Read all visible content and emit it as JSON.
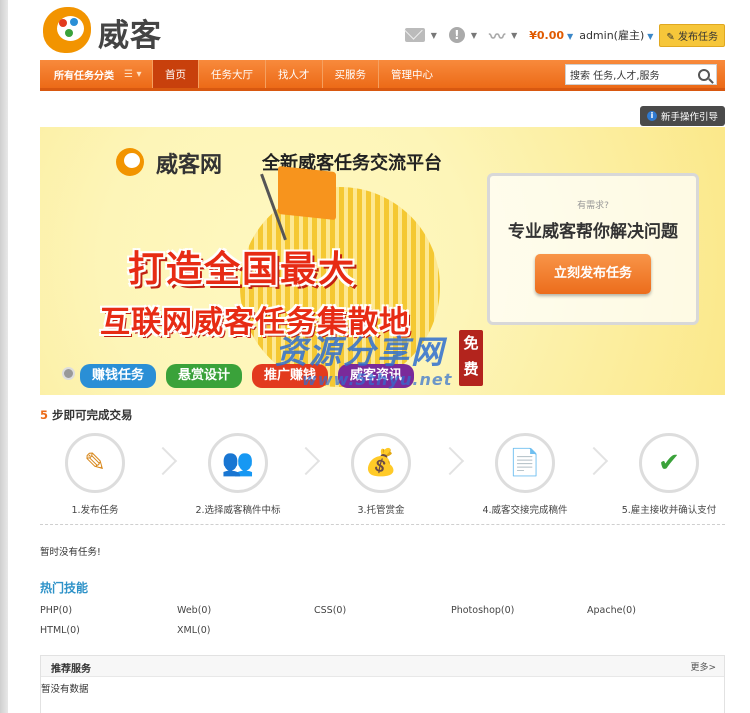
{
  "header": {
    "logo_text": "威客",
    "balance": "¥0.00",
    "user": "admin(雇主)",
    "post_task": "发布任务",
    "icons": [
      "mail-icon",
      "alert-icon",
      "rss-icon"
    ]
  },
  "nav": {
    "category_label": "所有任务分类",
    "items": [
      "首页",
      "任务大厅",
      "找人才",
      "买服务",
      "管理中心"
    ],
    "active_index": 0,
    "search_value": "搜索 任务,人才,服务"
  },
  "guide_label": "新手操作引导",
  "banner": {
    "brand": "威客网",
    "slogan": "全新威客任务交流平台",
    "headline1": "打造全国最大",
    "headline2": "互联网威客任务集散地",
    "box_question": "有需求?",
    "box_title": "专业威客帮你解决问题",
    "box_button": "立刻发布任务",
    "pills": [
      {
        "label": "赚钱任务",
        "color": "#2a8fd6"
      },
      {
        "label": "悬赏设计",
        "color": "#3aa23a"
      },
      {
        "label": "推广赚钱",
        "color": "#e23a1e"
      },
      {
        "label": "威客资讯",
        "color": "#7a2a9a"
      }
    ],
    "watermark": "资源分享网",
    "watermark_url": "www.5thyu.net",
    "stamp": "免费"
  },
  "steps": {
    "count": "5",
    "title_rest": " 步即可完成交易",
    "items": [
      {
        "label": "1.发布任务",
        "icon": "pencil-plus-icon",
        "glyph": "✎"
      },
      {
        "label": "2.选择威客稿件中标",
        "icon": "people-icon",
        "glyph": "👥"
      },
      {
        "label": "3.托管赏金",
        "icon": "money-bag-icon",
        "glyph": "💰"
      },
      {
        "label": "4.威客交接完成稿件",
        "icon": "document-icon",
        "glyph": "📄"
      },
      {
        "label": "5.雇主接收并确认支付",
        "icon": "checkmark-icon",
        "glyph": "✔"
      }
    ]
  },
  "no_tasks": "暂时没有任务!",
  "skills": {
    "title": "热门技能",
    "items": [
      "PHP(0)",
      "Web(0)",
      "CSS(0)",
      "Photoshop(0)",
      "Apache(0)",
      "HTML(0)",
      "XML(0)"
    ]
  },
  "recommend": {
    "title": "推荐服务",
    "more": "更多>",
    "empty": "暂没有数据"
  },
  "colors": {
    "accent": "#ec6a17",
    "skill_title": "#2e92c8"
  }
}
